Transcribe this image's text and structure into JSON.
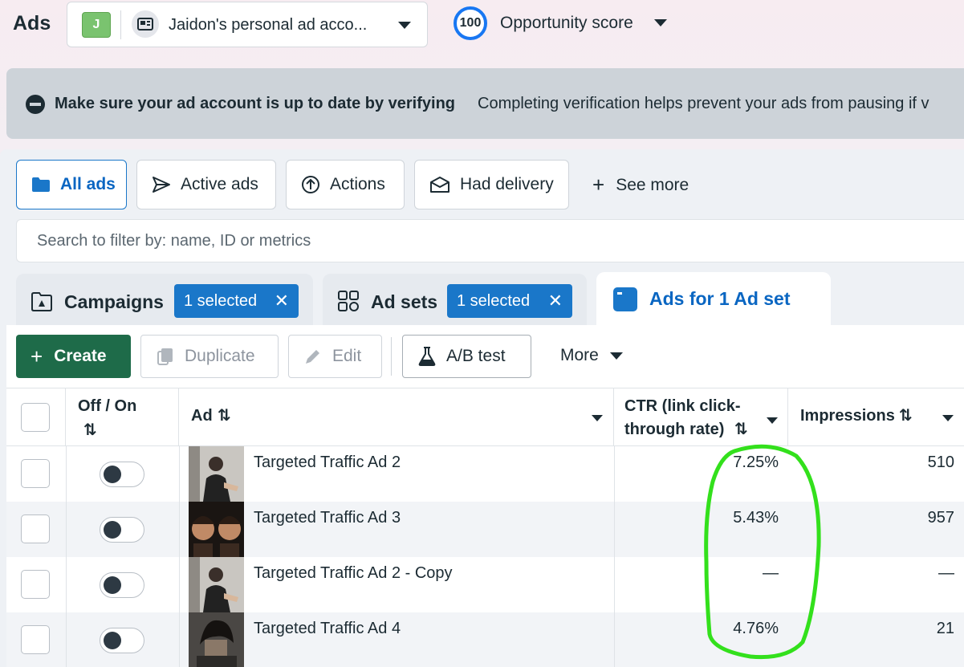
{
  "app": {
    "title": "Ads"
  },
  "account": {
    "avatar_letter": "J",
    "name": "Jaidon's personal ad acco..."
  },
  "opportunity": {
    "score": "100",
    "label": "Opportunity score"
  },
  "banner": {
    "title": "Make sure your ad account is up to date by verifying",
    "text": "Completing verification helps prevent your ads from pausing if v"
  },
  "filters": [
    {
      "label": "All ads",
      "icon": "folder-icon",
      "active": true
    },
    {
      "label": "Active ads",
      "icon": "send-icon",
      "active": false
    },
    {
      "label": "Actions",
      "icon": "upload-circle-icon",
      "active": false
    },
    {
      "label": "Had delivery",
      "icon": "envelope-icon",
      "active": false
    }
  ],
  "see_more": "See more",
  "search": {
    "placeholder": "Search to filter by: name, ID or metrics"
  },
  "levels": {
    "campaigns": {
      "label": "Campaigns",
      "chip": "1 selected"
    },
    "adsets": {
      "label": "Ad sets",
      "chip": "1 selected"
    },
    "ads": {
      "label": "Ads for 1 Ad set"
    }
  },
  "toolbar": {
    "create": "Create",
    "duplicate": "Duplicate",
    "edit": "Edit",
    "ab_test": "A/B test",
    "more": "More"
  },
  "table": {
    "headers": {
      "off_on_line1": "Off / On",
      "ad": "Ad",
      "ctr_line1": "CTR (link click-",
      "ctr_line2": "through rate)",
      "impressions": "Impressions",
      "sort_glyph": "⇅"
    },
    "rows": [
      {
        "name": "Targeted Traffic Ad 2",
        "ctr": "7.25%",
        "impressions": "510",
        "on": false
      },
      {
        "name": "Targeted Traffic Ad 3",
        "ctr": "5.43%",
        "impressions": "957",
        "on": false
      },
      {
        "name": "Targeted Traffic Ad 2 - Copy",
        "ctr": "—",
        "impressions": "—",
        "on": false
      },
      {
        "name": "Targeted Traffic Ad 4",
        "ctr": "4.76%",
        "impressions": "21",
        "on": false
      }
    ]
  },
  "colors": {
    "primary_blue": "#1a77c9",
    "create_green": "#1e6b49",
    "annotation_green": "#33e01c"
  }
}
